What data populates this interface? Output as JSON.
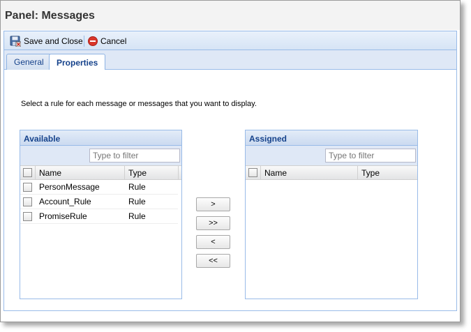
{
  "window": {
    "title": "Panel: Messages"
  },
  "toolbar": {
    "save_close_label": "Save and Close",
    "cancel_label": "Cancel"
  },
  "tabs": [
    {
      "label": "General",
      "active": false
    },
    {
      "label": "Properties",
      "active": true
    }
  ],
  "instruction": "Select a rule for each message or messages that you want to display.",
  "available": {
    "title": "Available",
    "filter_placeholder": "Type to filter",
    "columns": {
      "name": "Name",
      "type": "Type"
    },
    "rows": [
      {
        "name": "PersonMessage",
        "type": "Rule"
      },
      {
        "name": "Account_Rule",
        "type": "Rule"
      },
      {
        "name": "PromiseRule",
        "type": "Rule"
      }
    ]
  },
  "assigned": {
    "title": "Assigned",
    "filter_placeholder": "Type to filter",
    "columns": {
      "name": "Name",
      "type": "Type"
    },
    "rows": []
  },
  "move_buttons": {
    "add": ">",
    "add_all": ">>",
    "remove": "<",
    "remove_all": "<<"
  },
  "colors": {
    "accent": "#15428b",
    "border": "#99bbe8",
    "header_bg": "#dfe8f6",
    "cancel_red": "#d9362b"
  }
}
